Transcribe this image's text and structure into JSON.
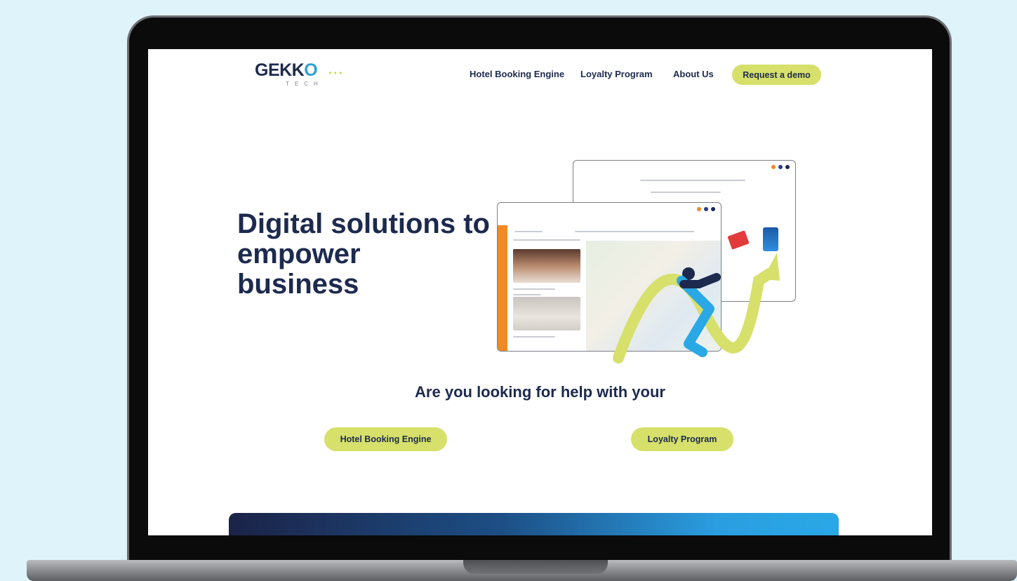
{
  "logo": {
    "word_prefix": "GEKK",
    "word_o": "O",
    "dots": "•••",
    "sub": "TECH"
  },
  "nav": {
    "items": [
      "Hotel Booking Engine",
      "Loyalty Program",
      "About Us"
    ],
    "cta": "Request a demo"
  },
  "hero": {
    "headline": "Digital solutions to empower business"
  },
  "help": {
    "question": "Are you looking for help with your",
    "buttons": [
      "Hotel Booking Engine",
      "Loyalty Program"
    ]
  },
  "colors": {
    "accent": "#d6e06a",
    "navy": "#1d2a4e",
    "brand_blue": "#2f9fd8",
    "orange": "#f08a24",
    "background": "#dff3fb"
  }
}
